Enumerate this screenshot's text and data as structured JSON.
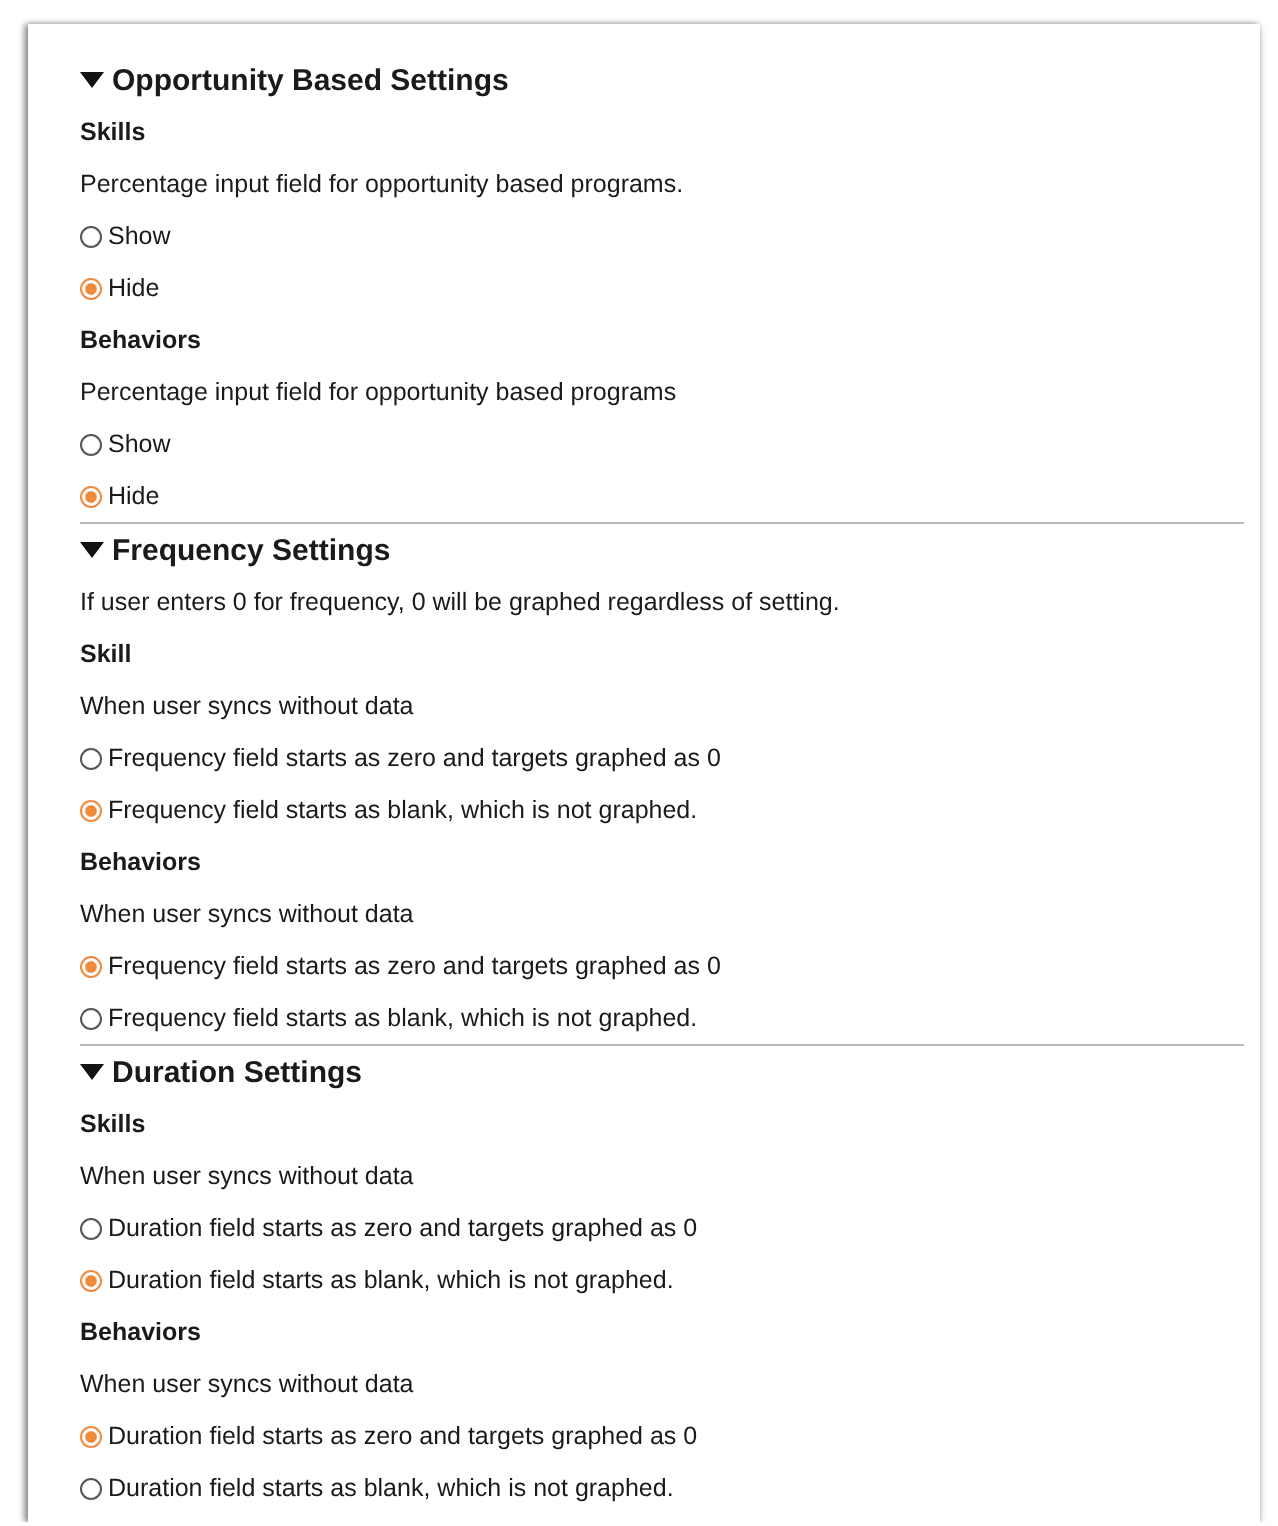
{
  "sections": [
    {
      "title": "Opportunity Based Settings",
      "expanded": true,
      "groups": [
        {
          "label": "Skills",
          "prompt": "Percentage input field for opportunity based programs.",
          "options": [
            {
              "label": "Show",
              "selected": false
            },
            {
              "label": "Hide",
              "selected": true
            }
          ]
        },
        {
          "label": "Behaviors",
          "prompt": "Percentage input field for opportunity based programs",
          "options": [
            {
              "label": "Show",
              "selected": false
            },
            {
              "label": "Hide",
              "selected": true
            }
          ]
        }
      ]
    },
    {
      "title": "Frequency Settings",
      "expanded": true,
      "note": "If user enters 0 for frequency, 0 will be graphed regardless of setting.",
      "groups": [
        {
          "label": "Skill",
          "prompt": "When user syncs without data",
          "options": [
            {
              "label": "Frequency field starts as zero and targets graphed as 0",
              "selected": false
            },
            {
              "label": "Frequency field starts as blank, which is not graphed.",
              "selected": true
            }
          ]
        },
        {
          "label": "Behaviors",
          "prompt": "When user syncs without data",
          "options": [
            {
              "label": "Frequency field starts as zero and targets graphed as 0",
              "selected": true
            },
            {
              "label": "Frequency field starts as blank, which is not graphed.",
              "selected": false
            }
          ]
        }
      ]
    },
    {
      "title": "Duration Settings",
      "expanded": true,
      "groups": [
        {
          "label": "Skills",
          "prompt": "When user syncs without data",
          "options": [
            {
              "label": "Duration field starts as zero and targets graphed as 0",
              "selected": false
            },
            {
              "label": "Duration field starts as blank, which is not graphed.",
              "selected": true
            }
          ]
        },
        {
          "label": "Behaviors",
          "prompt": "When user syncs without data",
          "options": [
            {
              "label": "Duration field starts as zero and targets graphed as 0",
              "selected": true
            },
            {
              "label": "Duration field starts as blank, which is not graphed.",
              "selected": false
            }
          ]
        }
      ]
    }
  ]
}
